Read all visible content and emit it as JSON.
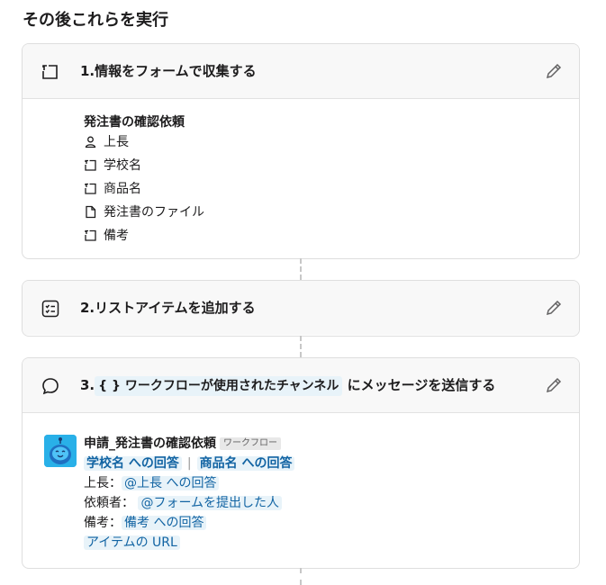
{
  "section_title": "その後これらを実行",
  "step1": {
    "title": "1.情報をフォームで収集する",
    "form_title": "発注書の確認依頼",
    "fields": [
      {
        "icon": "person-icon",
        "label": "上長"
      },
      {
        "icon": "text-field-icon",
        "label": "学校名"
      },
      {
        "icon": "text-field-icon",
        "label": "商品名"
      },
      {
        "icon": "file-icon",
        "label": "発注書のファイル"
      },
      {
        "icon": "text-field-icon",
        "label": "備考"
      }
    ]
  },
  "step2": {
    "title": "2.リストアイテムを追加する"
  },
  "step3": {
    "title_prefix": "3.",
    "channel_chip": "{ } ワークフローが使用されたチャンネル",
    "title_suffix": "にメッセージを送信する",
    "message": {
      "sender": "申請_発注書の確認依頼",
      "badge": "ワークフロー",
      "link1": "学校名 への回答",
      "link2": "商品名 への回答",
      "line1_label": "上長：",
      "line1_value": "@上長 への回答",
      "line2_label": "依頼者：",
      "line2_value": "@フォームを提出した人",
      "line3_label": "備考：",
      "line3_value": "備考 への回答",
      "line4_value": "アイテムの URL"
    }
  },
  "colors": {
    "link": "#1264a3",
    "chip_bg": "#e8f3f9",
    "avatar_bg": "#29b0e8"
  }
}
